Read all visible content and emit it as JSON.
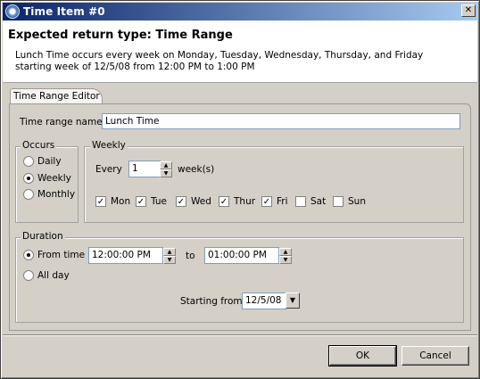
{
  "window": {
    "title": "Time Item #0",
    "close_glyph": "✕"
  },
  "header": {
    "title": "Expected return type: Time Range",
    "description_line1": "Lunch Time occurs every week on Monday, Tuesday, Wednesday, Thursday, and Friday",
    "description_line2": "starting week of 12/5/08 from 12:00 PM to 1:00 PM"
  },
  "tab": {
    "label": "Time Range Editor"
  },
  "name": {
    "label": "Time range name:",
    "value": "Lunch Time"
  },
  "occurs": {
    "legend": "Occurs",
    "options": [
      {
        "label": "Daily",
        "selected": false
      },
      {
        "label": "Weekly",
        "selected": true
      },
      {
        "label": "Monthly",
        "selected": false
      }
    ]
  },
  "weekly": {
    "legend": "Weekly",
    "every_label": "Every",
    "every_value": "1",
    "unit_label": "week(s)",
    "days": [
      {
        "label": "Mon",
        "checked": true
      },
      {
        "label": "Tue",
        "checked": true
      },
      {
        "label": "Wed",
        "checked": true
      },
      {
        "label": "Thur",
        "checked": true
      },
      {
        "label": "Fri",
        "checked": true
      },
      {
        "label": "Sat",
        "checked": false
      },
      {
        "label": "Sun",
        "checked": false
      }
    ]
  },
  "duration": {
    "legend": "Duration",
    "from_time_label": "From time",
    "from_time_value": "12:00:00 PM",
    "to_label": "to",
    "to_time_value": "01:00:00 PM",
    "all_day_label": "All day",
    "from_time_selected": true,
    "all_day_selected": false,
    "starting_from_label": "Starting from",
    "starting_from_value": "12/5/08"
  },
  "buttons": {
    "ok": "OK",
    "cancel": "Cancel"
  },
  "icons": {
    "check_glyph": "✓",
    "spin_up": "▲",
    "spin_down": "▼",
    "dropdown": "▼"
  }
}
